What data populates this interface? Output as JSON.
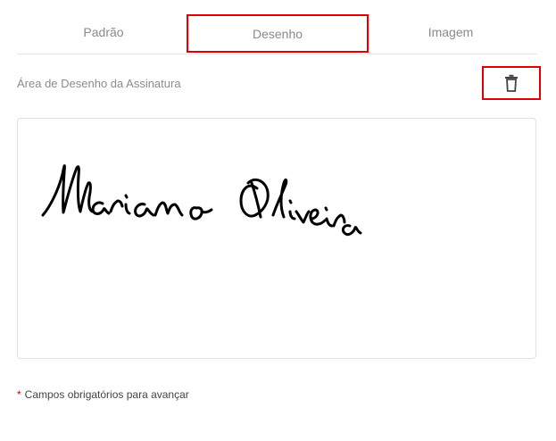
{
  "tabs": {
    "padrao": "Padrão",
    "desenho": "Desenho",
    "imagem": "Imagem",
    "active": "Desenho"
  },
  "drawing_area": {
    "label": "Área de Desenho da Assinatura",
    "clear_icon": "trash-icon"
  },
  "footer": {
    "asterisk": "*",
    "required_text": "Campos obrigatórios para avançar"
  },
  "colors": {
    "highlight": "#e00000",
    "ink": "#000000"
  }
}
